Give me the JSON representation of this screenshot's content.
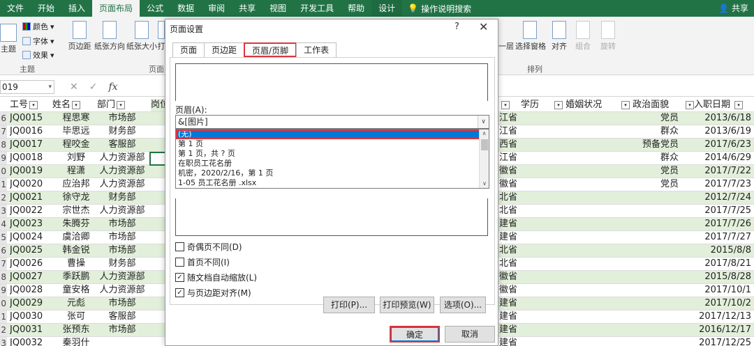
{
  "ribbon_tabs": [
    "文件",
    "开始",
    "插入",
    "页面布局",
    "公式",
    "数据",
    "审阅",
    "共享",
    "视图",
    "开发工具",
    "帮助",
    "设计"
  ],
  "active_tab": "页面布局",
  "help_search": "操作说明搜索",
  "share": "共享",
  "ribbon": {
    "theme": "主题",
    "colors": "颜色",
    "fonts": "字体",
    "effects": "效果",
    "margins": "页边距",
    "orientation": "纸张方向",
    "size": "纸张大小",
    "print_area": "打",
    "group_theme": "主题",
    "group_page": "页面",
    "bring": "一层",
    "selection_pane": "选择窗格",
    "align": "对齐",
    "group": "组合",
    "rotate": "旋转",
    "group_arrange": "排列"
  },
  "namebox": "019",
  "fx": "fx",
  "columns": {
    "c_id": "工号",
    "c_name": "姓名",
    "c_dept": "部门",
    "c_post": "岗位",
    "c_edu": "学历",
    "c_marital": "婚姻状况",
    "c_political": "政治面貌",
    "c_date": "入职日期"
  },
  "rows": [
    {
      "n": "6",
      "id": "JQ0015",
      "name": "程思寒",
      "dept": "市场部",
      "prov": "江省",
      "pol": "党员",
      "date": "2013/6/18",
      "band": true
    },
    {
      "n": "7",
      "id": "JQ0016",
      "name": "毕思远",
      "dept": "财务部",
      "prov": "江省",
      "pol": "群众",
      "date": "2013/6/19",
      "band": false
    },
    {
      "n": "8",
      "id": "JQ0017",
      "name": "程咬金",
      "dept": "客服部",
      "prov": "西省",
      "pol": "预备党员",
      "date": "2017/6/23",
      "band": true
    },
    {
      "n": "9",
      "id": "JQ0018",
      "name": "刘野",
      "dept": "人力资源部",
      "prov": "江省",
      "pol": "群众",
      "date": "2014/6/29",
      "band": false
    },
    {
      "n": "0",
      "id": "JQ0019",
      "name": "程潇",
      "dept": "人力资源部",
      "prov": "徽省",
      "pol": "党员",
      "date": "2017/7/22",
      "band": true
    },
    {
      "n": "1",
      "id": "JQ0020",
      "name": "应治邦",
      "dept": "人力资源部",
      "prov": "徽省",
      "pol": "党员",
      "date": "2017/7/23",
      "band": false
    },
    {
      "n": "2",
      "id": "JQ0021",
      "name": "徐守龙",
      "dept": "财务部",
      "prov": "北省",
      "pol": "",
      "date": "2012/7/24",
      "band": true
    },
    {
      "n": "3",
      "id": "JQ0022",
      "name": "宗世杰",
      "dept": "人力资源部",
      "prov": "北省",
      "pol": "",
      "date": "2017/7/25",
      "band": false
    },
    {
      "n": "4",
      "id": "JQ0023",
      "name": "朱腾芬",
      "dept": "市场部",
      "prov": "建省",
      "pol": "",
      "date": "2017/7/26",
      "band": true
    },
    {
      "n": "5",
      "id": "JQ0024",
      "name": "虞洽卿",
      "dept": "市场部",
      "prov": "建省",
      "pol": "",
      "date": "2017/7/27",
      "band": false
    },
    {
      "n": "6",
      "id": "JQ0025",
      "name": "韩金锐",
      "dept": "市场部",
      "prov": "北省",
      "pol": "",
      "date": "2015/8/8",
      "band": true
    },
    {
      "n": "7",
      "id": "JQ0026",
      "name": "曹操",
      "dept": "财务部",
      "prov": "北省",
      "pol": "",
      "date": "2017/8/21",
      "band": false
    },
    {
      "n": "8",
      "id": "JQ0027",
      "name": "季跃鹏",
      "dept": "人力资源部",
      "prov": "徽省",
      "pol": "",
      "date": "2015/8/28",
      "band": true
    },
    {
      "n": "9",
      "id": "JQ0028",
      "name": "童安格",
      "dept": "人力资源部",
      "prov": "徽省",
      "pol": "",
      "date": "2017/10/1",
      "band": false
    },
    {
      "n": "0",
      "id": "JQ0029",
      "name": "元彪",
      "dept": "市场部",
      "prov": "建省",
      "pol": "",
      "date": "2017/10/2",
      "band": true
    },
    {
      "n": "1",
      "id": "JQ0030",
      "name": "张可",
      "dept": "客服部",
      "prov": "建省",
      "pol": "",
      "date": "2017/12/13",
      "band": false
    },
    {
      "n": "2",
      "id": "JQ0031",
      "name": "张预东",
      "dept": "市场部",
      "prov": "建省",
      "pol": "",
      "date": "2016/12/17",
      "band": true
    },
    {
      "n": "3",
      "id": "JQ0032",
      "name": "秦羽什",
      "dept": "",
      "prov": "建省",
      "pol": "",
      "date": "2017/12/25",
      "band": false
    }
  ],
  "dialog": {
    "title": "页面设置",
    "help": "?",
    "close": "✕",
    "tabs": [
      "页面",
      "页边距",
      "页眉/页脚",
      "工作表"
    ],
    "header_label": "页眉(A):",
    "header_value": "&[图片]",
    "dropdown_items": [
      "(无)",
      "第 1 页",
      "第 1 页，共 ? 页",
      "在职员工花名册",
      " 机密，2020/2/16，第 1 页",
      "1-05 员工花名册 .xlsx"
    ],
    "checkboxes": [
      {
        "label": "奇偶页不同(D)",
        "checked": ""
      },
      {
        "label": "首页不同(I)",
        "checked": ""
      },
      {
        "label": "随文档自动缩放(L)",
        "checked": "✓"
      },
      {
        "label": "与页边距对齐(M)",
        "checked": "✓"
      }
    ],
    "btn_print": "打印(P)...",
    "btn_preview": "打印预览(W)",
    "btn_options": "选项(O)...",
    "btn_ok": "确定",
    "btn_cancel": "取消"
  },
  "colors": {
    "ribbon_green": "#217346",
    "band": "#e2efda",
    "highlight": "#d9363e",
    "select": "#0078d7"
  }
}
